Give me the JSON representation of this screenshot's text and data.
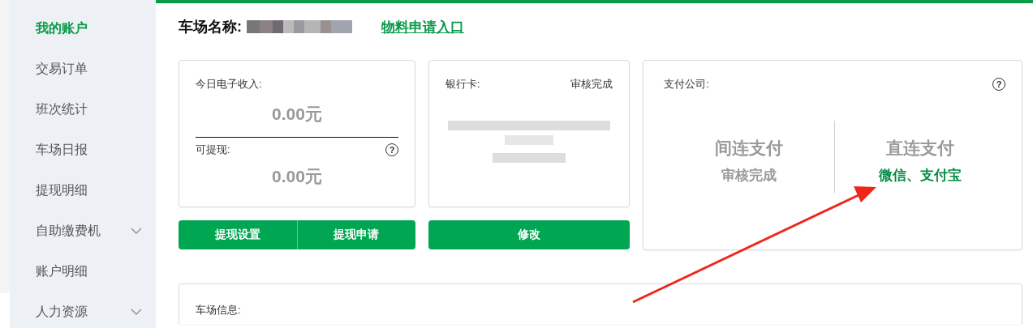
{
  "sidebar": {
    "items": [
      {
        "label": "我的账户",
        "selected": true,
        "expandable": false
      },
      {
        "label": "交易订单",
        "selected": false,
        "expandable": false
      },
      {
        "label": "班次统计",
        "selected": false,
        "expandable": false
      },
      {
        "label": "车场日报",
        "selected": false,
        "expandable": false
      },
      {
        "label": "提现明细",
        "selected": false,
        "expandable": false
      },
      {
        "label": "自助缴费机",
        "selected": false,
        "expandable": true
      },
      {
        "label": "账户明细",
        "selected": false,
        "expandable": false
      },
      {
        "label": "人力资源",
        "selected": false,
        "expandable": true
      }
    ]
  },
  "header": {
    "label": "车场名称:",
    "link": "物料申请入口"
  },
  "income_card": {
    "today_label": "今日电子收入:",
    "today_value": "0.00元",
    "withdrawable_label": "可提现:",
    "help": "?",
    "withdrawable_value": "0.00元",
    "buttons": [
      "提现设置",
      "提现申请"
    ]
  },
  "bank_card": {
    "label": "银行卡:",
    "status": "审核完成",
    "button": "修改"
  },
  "payment_card": {
    "label": "支付公司:",
    "help": "?",
    "options": [
      {
        "title": "间连支付",
        "detail": "审核完成",
        "highlight": false
      },
      {
        "title": "直连支付",
        "detail": "微信、支付宝",
        "highlight": true
      }
    ]
  },
  "info_card": {
    "label": "车场信息:"
  }
}
